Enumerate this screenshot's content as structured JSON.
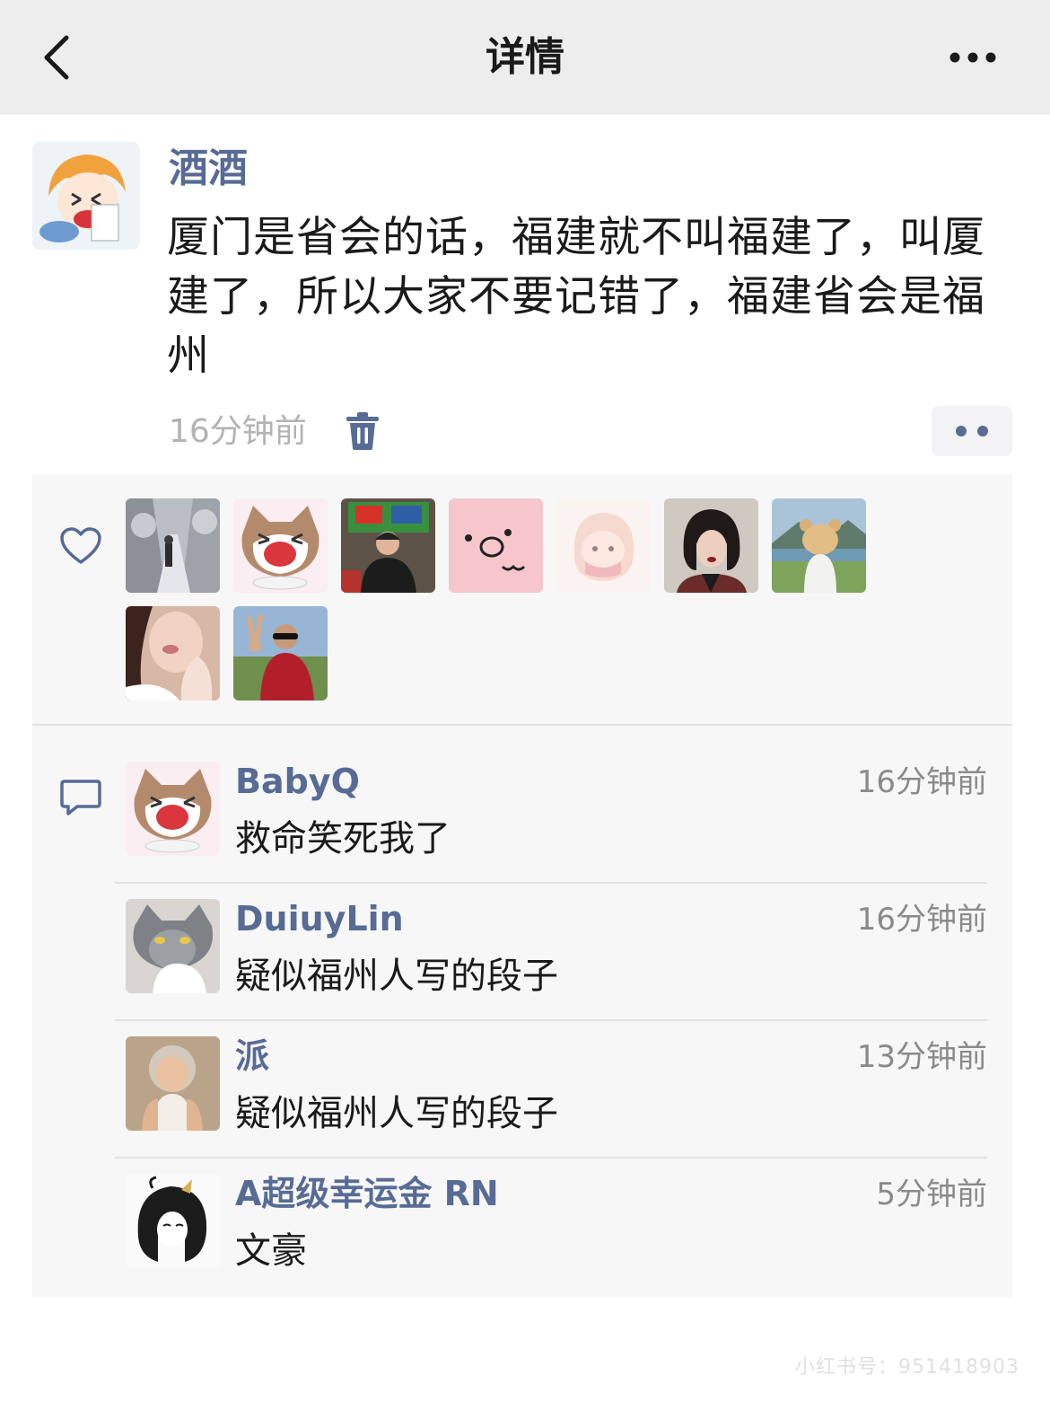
{
  "nav": {
    "title": "详情"
  },
  "post": {
    "author": "酒酒",
    "text": "厦门是省会的话，福建就不叫福建了，叫厦建了，所以大家不要记错了，福建省会是福州",
    "time": "16分钟前"
  },
  "comments": [
    {
      "name": "BabyQ",
      "time": "16分钟前",
      "text": "救命笑死我了"
    },
    {
      "name": "DuiuyLin",
      "time": "16分钟前",
      "text": "疑似福州人写的段子"
    },
    {
      "name": "派",
      "time": "13分钟前",
      "text": "疑似福州人写的段子"
    },
    {
      "name": "A超级幸运金 RN",
      "time": "5分钟前",
      "text": "文豪"
    }
  ],
  "watermark": "小红书号：951418903",
  "colors": {
    "link_blue": "#576b95",
    "nav_bg": "#ededed",
    "panel_bg": "#f7f7f7"
  },
  "icons": {
    "back": "chevron-left-icon",
    "more": "more-dots-icon",
    "delete": "trash-icon",
    "like": "heart-icon",
    "comment": "comment-bubble-icon"
  }
}
